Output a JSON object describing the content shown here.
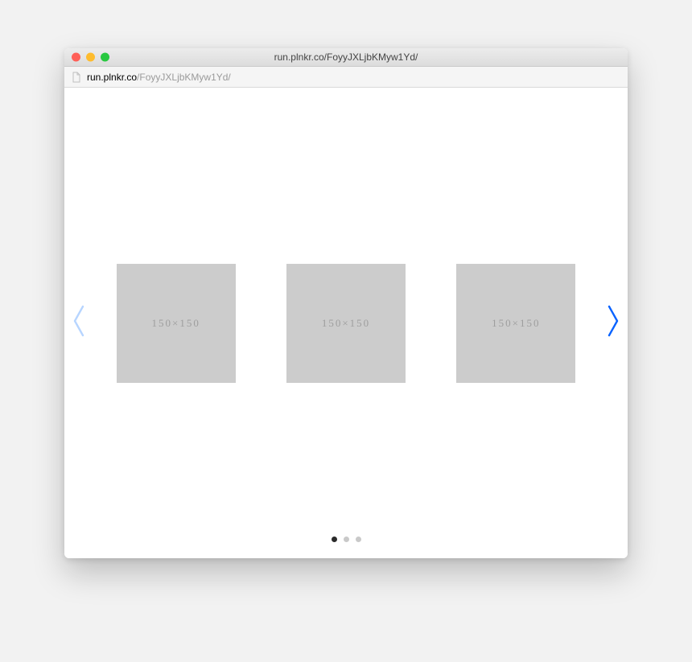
{
  "window": {
    "title": "run.plnkr.co/FoyyJXLjbKMyw1Yd/"
  },
  "address": {
    "host": "run.plnkr.co",
    "path": "/FoyyJXLjbKMyw1Yd/"
  },
  "carousel": {
    "slides": [
      {
        "label": "150×150"
      },
      {
        "label": "150×150"
      },
      {
        "label": "150×150"
      }
    ],
    "pagination": {
      "count": 3,
      "active_index": 0
    }
  },
  "colors": {
    "placeholder_fill": "#cccccc",
    "arrow_active": "#0a63ff",
    "arrow_disabled": "#b7d5ff"
  }
}
